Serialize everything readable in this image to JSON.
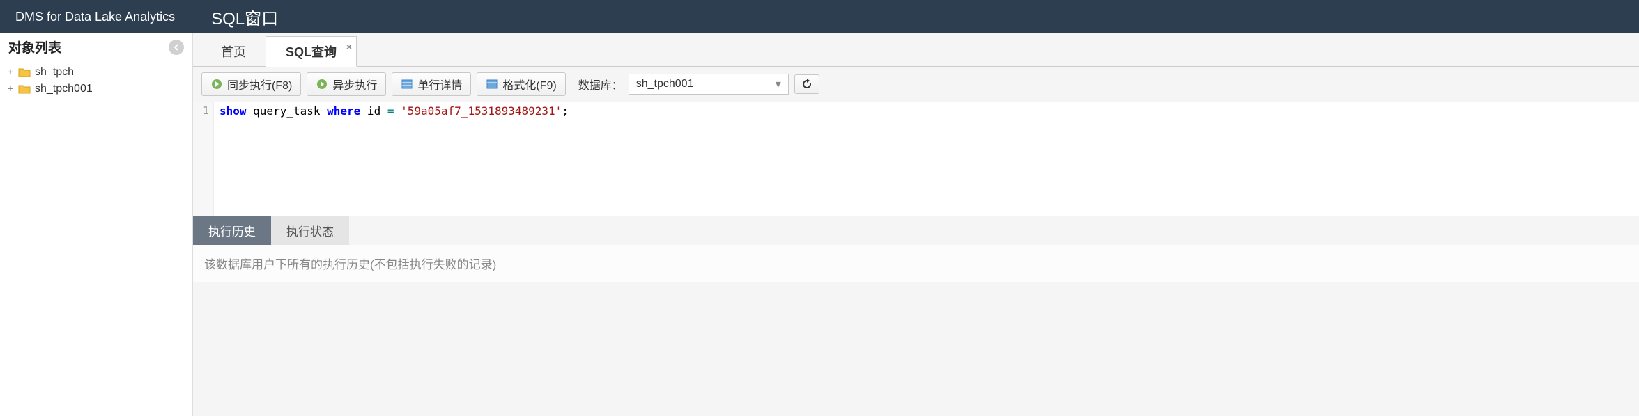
{
  "header": {
    "product_name": "DMS for Data Lake Analytics",
    "title": "SQL窗口"
  },
  "sidebar": {
    "title": "对象列表",
    "items": [
      {
        "label": "sh_tpch"
      },
      {
        "label": "sh_tpch001"
      }
    ]
  },
  "main_tabs": [
    {
      "label": "首页",
      "active": false
    },
    {
      "label": "SQL查询",
      "active": true,
      "closable": true
    }
  ],
  "toolbar": {
    "sync_run": "同步执行(F8)",
    "async_run": "异步执行",
    "row_detail": "单行详情",
    "format": "格式化(F9)",
    "db_label": "数据库：",
    "db_selected": "sh_tpch001"
  },
  "editor": {
    "lines": [
      {
        "num": "1",
        "tokens": [
          {
            "t": "show",
            "c": "kw-blue"
          },
          {
            "t": " query_task ",
            "c": "plain"
          },
          {
            "t": "where",
            "c": "kw-blue"
          },
          {
            "t": " id ",
            "c": "plain"
          },
          {
            "t": "=",
            "c": "kw-teal"
          },
          {
            "t": " ",
            "c": "plain"
          },
          {
            "t": "'59a05af7_1531893489231'",
            "c": "lit-str"
          },
          {
            "t": ";",
            "c": "plain"
          }
        ]
      }
    ]
  },
  "bottom_tabs": [
    {
      "label": "执行历史",
      "active": true
    },
    {
      "label": "执行状态",
      "active": false
    }
  ],
  "history_note": "该数据库用户下所有的执行历史(不包括执行失败的记录)"
}
